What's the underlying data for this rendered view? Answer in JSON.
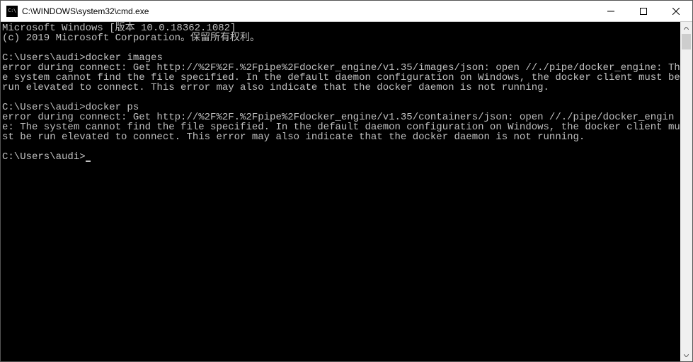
{
  "window": {
    "title": "C:\\WINDOWS\\system32\\cmd.exe"
  },
  "console": {
    "banner_line1": "Microsoft Windows [版本 10.0.18362.1082]",
    "banner_line2": "(c) 2019 Microsoft Corporation。保留所有权利。",
    "blank": "",
    "prompt1": "C:\\Users\\audi>",
    "command1": "docker images",
    "output1": "error during connect: Get http://%2F%2F.%2Fpipe%2Fdocker_engine/v1.35/images/json: open //./pipe/docker_engine: The system cannot find the file specified. In the default daemon configuration on Windows, the docker client must be run elevated to connect. This error may also indicate that the docker daemon is not running.",
    "prompt2": "C:\\Users\\audi>",
    "command2": "docker ps",
    "output2": "error during connect: Get http://%2F%2F.%2Fpipe%2Fdocker_engine/v1.35/containers/json: open //./pipe/docker_engine: The system cannot find the file specified. In the default daemon configuration on Windows, the docker client must be run elevated to connect. This error may also indicate that the docker daemon is not running.",
    "prompt3": "C:\\Users\\audi>"
  }
}
